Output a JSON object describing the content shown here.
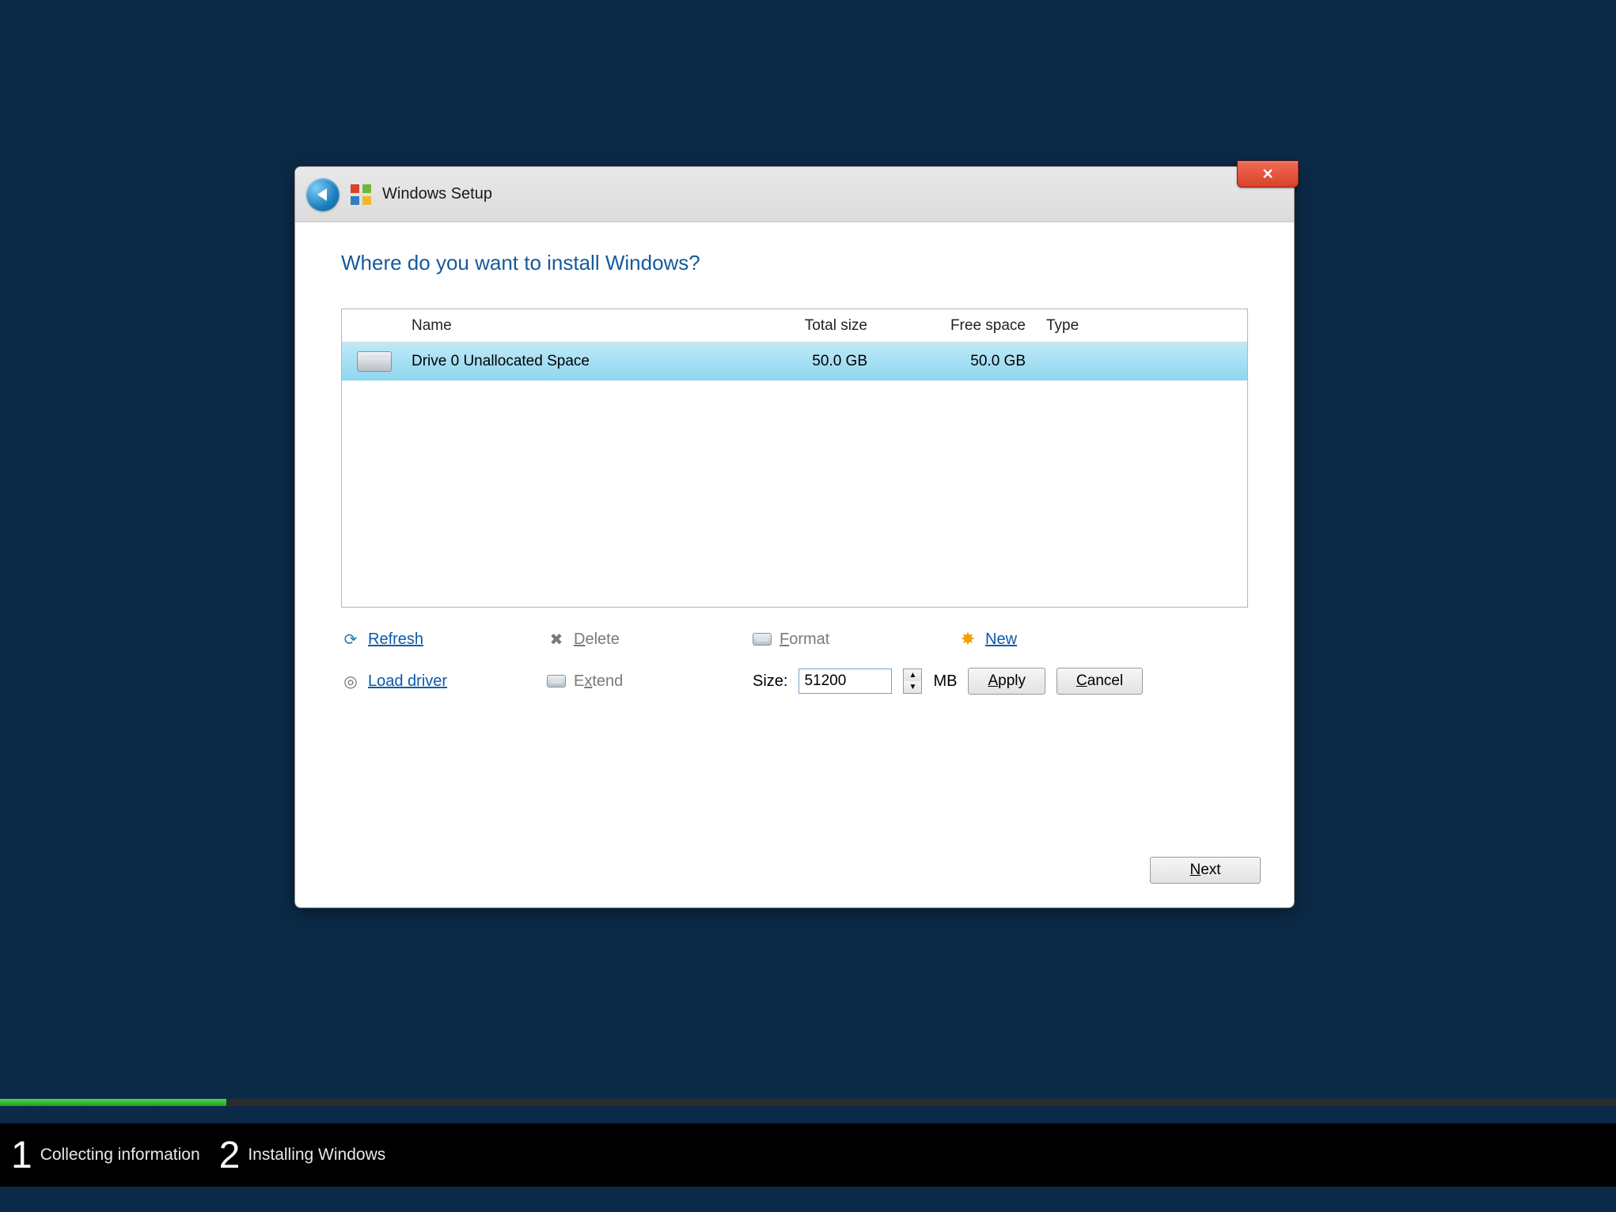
{
  "window": {
    "title": "Windows Setup"
  },
  "heading": "Where do you want to install Windows?",
  "table": {
    "headers": {
      "name": "Name",
      "total": "Total size",
      "free": "Free space",
      "type": "Type"
    },
    "rows": [
      {
        "name": "Drive 0 Unallocated Space",
        "total": "50.0 GB",
        "free": "50.0 GB",
        "type": ""
      }
    ]
  },
  "actions": {
    "refresh": "Refresh",
    "delete": "Delete",
    "format": "Format",
    "new": "New",
    "load_driver": "Load driver",
    "extend": "Extend"
  },
  "size": {
    "label": "Size:",
    "value": "51200",
    "unit": "MB",
    "apply": "Apply",
    "cancel": "Cancel"
  },
  "next": "Next",
  "progress": {
    "percent": 14
  },
  "steps": [
    {
      "num": "1",
      "label": "Collecting information"
    },
    {
      "num": "2",
      "label": "Installing Windows"
    }
  ]
}
